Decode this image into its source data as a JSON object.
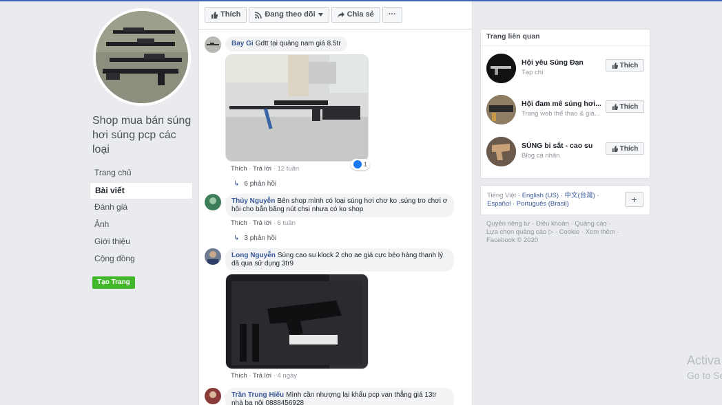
{
  "page": {
    "name": "Shop mua bán súng hơi súng pcp các loại"
  },
  "nav": {
    "items": [
      {
        "label": "Trang chủ",
        "active": false
      },
      {
        "label": "Bài viết",
        "active": true
      },
      {
        "label": "Đánh giá",
        "active": false
      },
      {
        "label": "Ảnh",
        "active": false
      },
      {
        "label": "Giới thiệu",
        "active": false
      },
      {
        "label": "Cộng đồng",
        "active": false
      }
    ],
    "create_page": "Tạo Trang"
  },
  "toolbar": {
    "like": "Thích",
    "following": "Đang theo dõi",
    "share": "Chia sẻ",
    "more": "···"
  },
  "comments": [
    {
      "author": "Bay Gi",
      "text": "Gdtt tại quảng nam giá 8.5tr",
      "like": "Thích",
      "reply": "Trả lời",
      "time": "12 tuần",
      "reactions": "1",
      "replies": "6 phản hồi"
    },
    {
      "author": "Thủy Nguyễn",
      "text": "Bên shop mình có loại súng hơi chơ ko ,súng tro chơi ơ hôi cho bắn băng nút chsi nhưa có ko shop",
      "like": "Thích",
      "reply": "Trả lời",
      "time": "6 tuần",
      "replies": "3 phản hồi"
    },
    {
      "author": "Long Nguyễn",
      "text": "Súng cao su klock 2 cho ae giá cực bèo hàng thanh lý đã qua sử dụng 3tr9",
      "like": "Thích",
      "reply": "Trả lời",
      "time": "4 ngày"
    },
    {
      "author": "Trần Trung Hiếu",
      "text": "Mình cần nhượng lại khẩu pcp van thẳng giá 13tr nhà ba nội 0888456928"
    }
  ],
  "related": {
    "title": "Trang liên quan",
    "items": [
      {
        "name": "Hội yêu Súng Đạn",
        "sub": "Tạp chí",
        "like": "Thích"
      },
      {
        "name": "Hội đam mê súng hơi...",
        "sub": "Trang web thể thao & giả...",
        "like": "Thích"
      },
      {
        "name": "SÚNG bi sắt - cao su",
        "sub": "Blog cá nhân",
        "like": "Thích"
      }
    ]
  },
  "languages": {
    "current": "Tiếng Việt",
    "others": [
      "English (US)",
      "中文(台灣)",
      "Español",
      "Português (Brasil)"
    ],
    "plus": "+"
  },
  "footer": {
    "line1": "Quyền riêng tư · Điều khoản · Quảng cáo ·",
    "line2": "Lựa chọn quảng cáo ▷ · Cookie · Xem thêm ·",
    "line3": "Facebook © 2020"
  },
  "watermark": {
    "line1": "Activa",
    "line2": "Go to Se"
  },
  "colors": {
    "fb_blue": "#4267b2",
    "link": "#385898",
    "green": "#42b72a",
    "background": "#e9ebee"
  }
}
